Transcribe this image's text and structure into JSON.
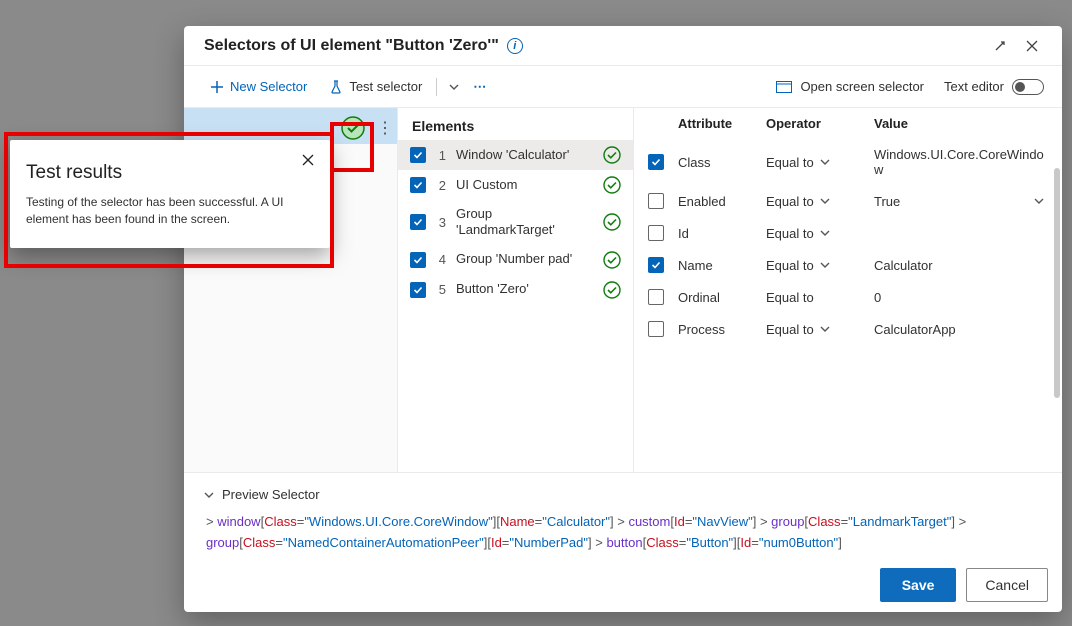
{
  "dialog": {
    "title": "Selectors of UI element \"Button 'Zero'\""
  },
  "toolbar": {
    "new_selector": "New Selector",
    "test_selector": "Test selector",
    "open_screen": "Open screen selector",
    "text_editor": "Text editor"
  },
  "elements_header": "Elements",
  "elements": [
    {
      "idx": "1",
      "label": "Window 'Calculator'",
      "checked": true,
      "status": "ok",
      "selected": true
    },
    {
      "idx": "2",
      "label": "UI Custom",
      "checked": true,
      "status": "ok",
      "selected": false
    },
    {
      "idx": "3",
      "label": "Group 'LandmarkTarget'",
      "checked": true,
      "status": "ok",
      "selected": false
    },
    {
      "idx": "4",
      "label": "Group 'Number pad'",
      "checked": true,
      "status": "ok",
      "selected": false
    },
    {
      "idx": "5",
      "label": "Button 'Zero'",
      "checked": true,
      "status": "ok",
      "selected": false
    }
  ],
  "attr_headers": {
    "attribute": "Attribute",
    "operator": "Operator",
    "value": "Value"
  },
  "attributes": [
    {
      "checked": true,
      "name": "Class",
      "operator": "Equal to",
      "value": "Windows.UI.Core.CoreWindow",
      "value_has_chevron": false
    },
    {
      "checked": false,
      "name": "Enabled",
      "operator": "Equal to",
      "value": "True",
      "value_has_chevron": true
    },
    {
      "checked": false,
      "name": "Id",
      "operator": "Equal to",
      "value": "",
      "value_has_chevron": false
    },
    {
      "checked": true,
      "name": "Name",
      "operator": "Equal to",
      "value": "Calculator",
      "value_has_chevron": false
    },
    {
      "checked": false,
      "name": "Ordinal",
      "operator": "Equal to",
      "value": "0",
      "value_has_chevron": false,
      "no_op_chevron": true
    },
    {
      "checked": false,
      "name": "Process",
      "operator": "Equal to",
      "value": "CalculatorApp",
      "value_has_chevron": false
    }
  ],
  "preview": {
    "label": "Preview Selector",
    "tokens": [
      {
        "t": "> ",
        "c": "punc"
      },
      {
        "t": "window",
        "c": "elem"
      },
      {
        "t": "[",
        "c": "punc"
      },
      {
        "t": "Class",
        "c": "attr"
      },
      {
        "t": "=",
        "c": "punc"
      },
      {
        "t": "\"Windows.UI.Core.CoreWindow\"",
        "c": "val"
      },
      {
        "t": "][",
        "c": "punc"
      },
      {
        "t": "Name",
        "c": "attr"
      },
      {
        "t": "=",
        "c": "punc"
      },
      {
        "t": "\"Calculator\"",
        "c": "val"
      },
      {
        "t": "]",
        "c": "punc"
      },
      {
        "t": " > ",
        "c": "punc"
      },
      {
        "t": "custom",
        "c": "elem"
      },
      {
        "t": "[",
        "c": "punc"
      },
      {
        "t": "Id",
        "c": "attr"
      },
      {
        "t": "=",
        "c": "punc"
      },
      {
        "t": "\"NavView\"",
        "c": "val"
      },
      {
        "t": "]",
        "c": "punc"
      },
      {
        "t": " > ",
        "c": "punc"
      },
      {
        "t": "group",
        "c": "elem"
      },
      {
        "t": "[",
        "c": "punc"
      },
      {
        "t": "Class",
        "c": "attr"
      },
      {
        "t": "=",
        "c": "punc"
      },
      {
        "t": "\"LandmarkTarget\"",
        "c": "val"
      },
      {
        "t": "]",
        "c": "punc"
      },
      {
        "t": " > ",
        "c": "punc"
      },
      {
        "t": "group",
        "c": "elem"
      },
      {
        "t": "[",
        "c": "punc"
      },
      {
        "t": "Class",
        "c": "attr"
      },
      {
        "t": "=",
        "c": "punc"
      },
      {
        "t": "\"NamedContainerAutomationPeer\"",
        "c": "val"
      },
      {
        "t": "][",
        "c": "punc"
      },
      {
        "t": "Id",
        "c": "attr"
      },
      {
        "t": "=",
        "c": "punc"
      },
      {
        "t": "\"NumberPad\"",
        "c": "val"
      },
      {
        "t": "]",
        "c": "punc"
      },
      {
        "t": " > ",
        "c": "punc"
      },
      {
        "t": "button",
        "c": "elem"
      },
      {
        "t": "[",
        "c": "punc"
      },
      {
        "t": "Class",
        "c": "attr"
      },
      {
        "t": "=",
        "c": "punc"
      },
      {
        "t": "\"Button\"",
        "c": "val"
      },
      {
        "t": "][",
        "c": "punc"
      },
      {
        "t": "Id",
        "c": "attr"
      },
      {
        "t": "=",
        "c": "punc"
      },
      {
        "t": "\"num0Button\"",
        "c": "val"
      },
      {
        "t": "]",
        "c": "punc"
      }
    ]
  },
  "buttons": {
    "save": "Save",
    "cancel": "Cancel"
  },
  "popup": {
    "title": "Test results",
    "body": "Testing of the selector has been successful. A UI element has been found in the screen."
  }
}
